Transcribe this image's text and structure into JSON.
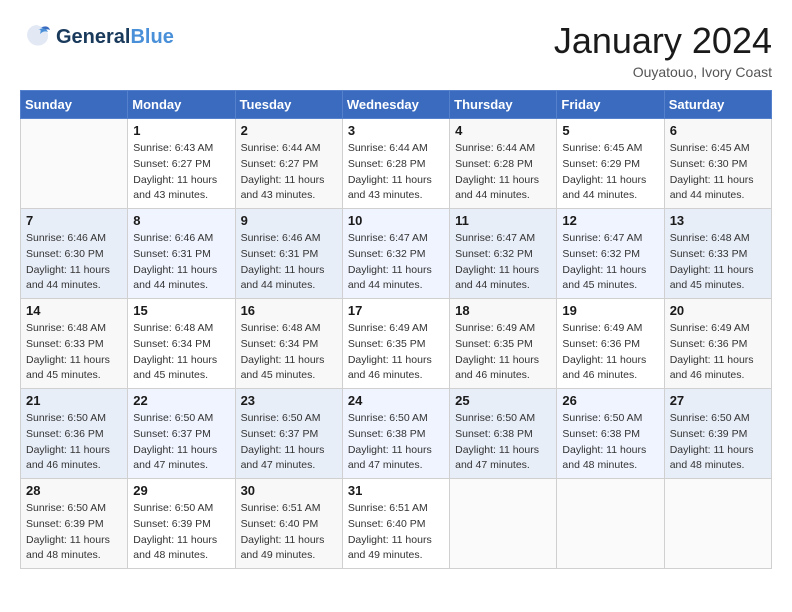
{
  "header": {
    "logo_general": "General",
    "logo_blue": "Blue",
    "month": "January 2024",
    "location": "Ouyatouo, Ivory Coast"
  },
  "days_of_week": [
    "Sunday",
    "Monday",
    "Tuesday",
    "Wednesday",
    "Thursday",
    "Friday",
    "Saturday"
  ],
  "weeks": [
    [
      {
        "day": "",
        "info": ""
      },
      {
        "day": "1",
        "info": "Sunrise: 6:43 AM\nSunset: 6:27 PM\nDaylight: 11 hours\nand 43 minutes."
      },
      {
        "day": "2",
        "info": "Sunrise: 6:44 AM\nSunset: 6:27 PM\nDaylight: 11 hours\nand 43 minutes."
      },
      {
        "day": "3",
        "info": "Sunrise: 6:44 AM\nSunset: 6:28 PM\nDaylight: 11 hours\nand 43 minutes."
      },
      {
        "day": "4",
        "info": "Sunrise: 6:44 AM\nSunset: 6:28 PM\nDaylight: 11 hours\nand 44 minutes."
      },
      {
        "day": "5",
        "info": "Sunrise: 6:45 AM\nSunset: 6:29 PM\nDaylight: 11 hours\nand 44 minutes."
      },
      {
        "day": "6",
        "info": "Sunrise: 6:45 AM\nSunset: 6:30 PM\nDaylight: 11 hours\nand 44 minutes."
      }
    ],
    [
      {
        "day": "7",
        "info": "Sunrise: 6:46 AM\nSunset: 6:30 PM\nDaylight: 11 hours\nand 44 minutes."
      },
      {
        "day": "8",
        "info": "Sunrise: 6:46 AM\nSunset: 6:31 PM\nDaylight: 11 hours\nand 44 minutes."
      },
      {
        "day": "9",
        "info": "Sunrise: 6:46 AM\nSunset: 6:31 PM\nDaylight: 11 hours\nand 44 minutes."
      },
      {
        "day": "10",
        "info": "Sunrise: 6:47 AM\nSunset: 6:32 PM\nDaylight: 11 hours\nand 44 minutes."
      },
      {
        "day": "11",
        "info": "Sunrise: 6:47 AM\nSunset: 6:32 PM\nDaylight: 11 hours\nand 44 minutes."
      },
      {
        "day": "12",
        "info": "Sunrise: 6:47 AM\nSunset: 6:32 PM\nDaylight: 11 hours\nand 45 minutes."
      },
      {
        "day": "13",
        "info": "Sunrise: 6:48 AM\nSunset: 6:33 PM\nDaylight: 11 hours\nand 45 minutes."
      }
    ],
    [
      {
        "day": "14",
        "info": "Sunrise: 6:48 AM\nSunset: 6:33 PM\nDaylight: 11 hours\nand 45 minutes."
      },
      {
        "day": "15",
        "info": "Sunrise: 6:48 AM\nSunset: 6:34 PM\nDaylight: 11 hours\nand 45 minutes."
      },
      {
        "day": "16",
        "info": "Sunrise: 6:48 AM\nSunset: 6:34 PM\nDaylight: 11 hours\nand 45 minutes."
      },
      {
        "day": "17",
        "info": "Sunrise: 6:49 AM\nSunset: 6:35 PM\nDaylight: 11 hours\nand 46 minutes."
      },
      {
        "day": "18",
        "info": "Sunrise: 6:49 AM\nSunset: 6:35 PM\nDaylight: 11 hours\nand 46 minutes."
      },
      {
        "day": "19",
        "info": "Sunrise: 6:49 AM\nSunset: 6:36 PM\nDaylight: 11 hours\nand 46 minutes."
      },
      {
        "day": "20",
        "info": "Sunrise: 6:49 AM\nSunset: 6:36 PM\nDaylight: 11 hours\nand 46 minutes."
      }
    ],
    [
      {
        "day": "21",
        "info": "Sunrise: 6:50 AM\nSunset: 6:36 PM\nDaylight: 11 hours\nand 46 minutes."
      },
      {
        "day": "22",
        "info": "Sunrise: 6:50 AM\nSunset: 6:37 PM\nDaylight: 11 hours\nand 47 minutes."
      },
      {
        "day": "23",
        "info": "Sunrise: 6:50 AM\nSunset: 6:37 PM\nDaylight: 11 hours\nand 47 minutes."
      },
      {
        "day": "24",
        "info": "Sunrise: 6:50 AM\nSunset: 6:38 PM\nDaylight: 11 hours\nand 47 minutes."
      },
      {
        "day": "25",
        "info": "Sunrise: 6:50 AM\nSunset: 6:38 PM\nDaylight: 11 hours\nand 47 minutes."
      },
      {
        "day": "26",
        "info": "Sunrise: 6:50 AM\nSunset: 6:38 PM\nDaylight: 11 hours\nand 48 minutes."
      },
      {
        "day": "27",
        "info": "Sunrise: 6:50 AM\nSunset: 6:39 PM\nDaylight: 11 hours\nand 48 minutes."
      }
    ],
    [
      {
        "day": "28",
        "info": "Sunrise: 6:50 AM\nSunset: 6:39 PM\nDaylight: 11 hours\nand 48 minutes."
      },
      {
        "day": "29",
        "info": "Sunrise: 6:50 AM\nSunset: 6:39 PM\nDaylight: 11 hours\nand 48 minutes."
      },
      {
        "day": "30",
        "info": "Sunrise: 6:51 AM\nSunset: 6:40 PM\nDaylight: 11 hours\nand 49 minutes."
      },
      {
        "day": "31",
        "info": "Sunrise: 6:51 AM\nSunset: 6:40 PM\nDaylight: 11 hours\nand 49 minutes."
      },
      {
        "day": "",
        "info": ""
      },
      {
        "day": "",
        "info": ""
      },
      {
        "day": "",
        "info": ""
      }
    ]
  ]
}
